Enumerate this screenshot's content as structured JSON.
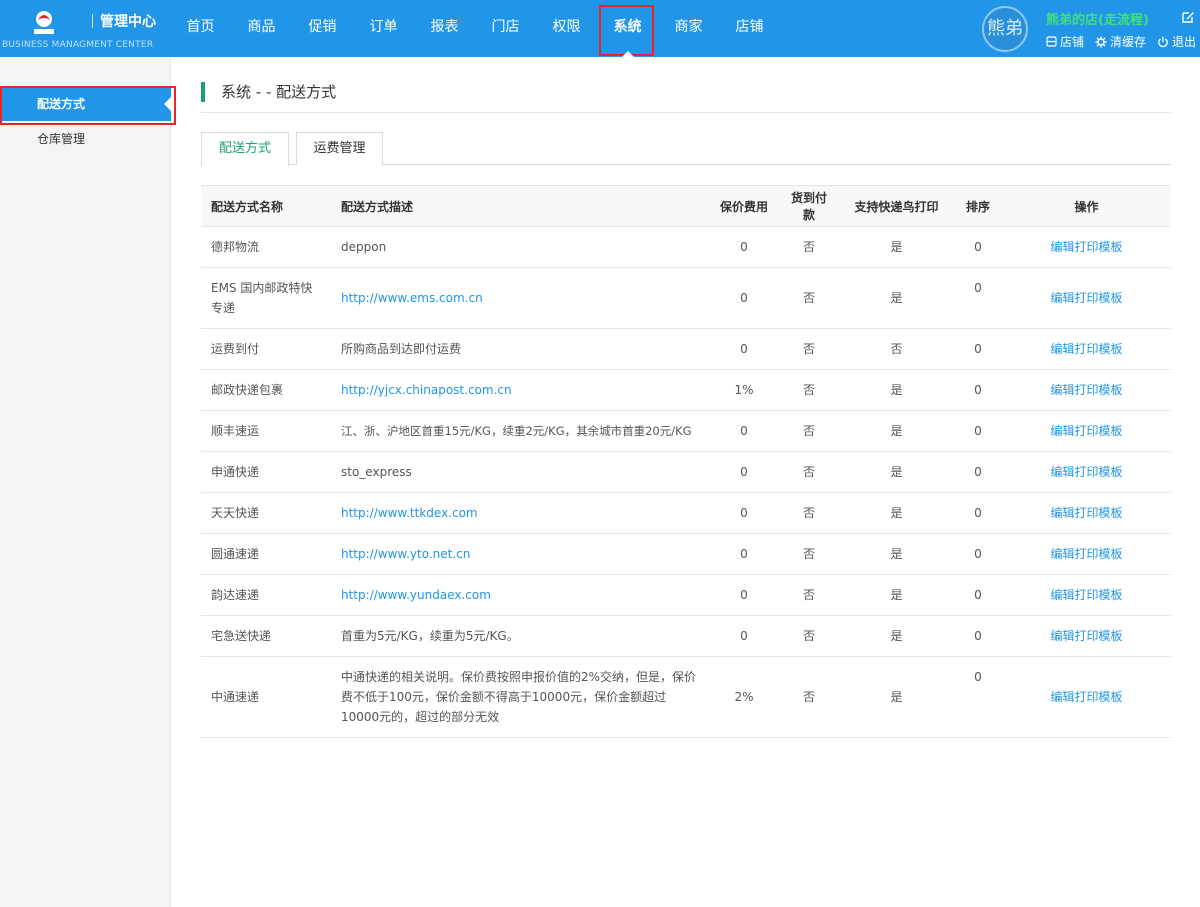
{
  "header": {
    "title": "管理中心",
    "subtitle": "BUSINESS MANAGMENT CENTER",
    "nav": [
      "首页",
      "商品",
      "促销",
      "订单",
      "报表",
      "门店",
      "权限",
      "系统",
      "商家",
      "店铺"
    ],
    "active_nav_index": 7,
    "avatar_text": "熊弟",
    "shop_name": "熊弟的店(走流程)",
    "actions": [
      {
        "label": "店铺",
        "icon": "store-icon"
      },
      {
        "label": "清缓存",
        "icon": "gear-icon"
      },
      {
        "label": "退出",
        "icon": "power-icon"
      }
    ],
    "colors": {
      "bar": "#2196e8",
      "active_outline": "#e8232a",
      "shop_name": "#42e07c"
    }
  },
  "sidebar": {
    "items": [
      "配送方式",
      "仓库管理"
    ],
    "active_index": 0
  },
  "page": {
    "title": "系统 - - 配送方式",
    "tabs": [
      "配送方式",
      "运费管理"
    ],
    "active_tab_index": 0
  },
  "table": {
    "headers": [
      "配送方式名称",
      "配送方式描述",
      "保价费用",
      "货到付款",
      "支持快递鸟打印",
      "排序",
      "操作"
    ],
    "rows": [
      {
        "name": "德邦物流",
        "desc": "deppon",
        "fee": "0",
        "cod": "否",
        "kdn": "是",
        "sort": "0",
        "op": "编辑打印模板"
      },
      {
        "name": "EMS 国内邮政特快专递",
        "desc": "http://www.ems.com.cn",
        "fee": "0",
        "cod": "否",
        "kdn": "是",
        "sort": "0",
        "op": "编辑打印模板"
      },
      {
        "name": "运费到付",
        "desc": "所购商品到达即付运费",
        "fee": "0",
        "cod": "否",
        "kdn": "否",
        "sort": "0",
        "op": "编辑打印模板"
      },
      {
        "name": "邮政快递包裹",
        "desc": "http://yjcx.chinapost.com.cn",
        "fee": "1%",
        "cod": "否",
        "kdn": "是",
        "sort": "0",
        "op": "编辑打印模板"
      },
      {
        "name": "顺丰速运",
        "desc": "江、浙、沪地区首重15元/KG，续重2元/KG，其余城市首重20元/KG",
        "fee": "0",
        "cod": "否",
        "kdn": "是",
        "sort": "0",
        "op": "编辑打印模板"
      },
      {
        "name": "申通快递",
        "desc": "sto_express",
        "fee": "0",
        "cod": "否",
        "kdn": "是",
        "sort": "0",
        "op": "编辑打印模板"
      },
      {
        "name": "天天快递",
        "desc": "http://www.ttkdex.com",
        "fee": "0",
        "cod": "否",
        "kdn": "是",
        "sort": "0",
        "op": "编辑打印模板"
      },
      {
        "name": "圆通速递",
        "desc": "http://www.yto.net.cn",
        "fee": "0",
        "cod": "否",
        "kdn": "是",
        "sort": "0",
        "op": "编辑打印模板"
      },
      {
        "name": "韵达速递",
        "desc": "http://www.yundaex.com",
        "fee": "0",
        "cod": "否",
        "kdn": "是",
        "sort": "0",
        "op": "编辑打印模板"
      },
      {
        "name": "宅急送快递",
        "desc": "首重为5元/KG，续重为5元/KG。",
        "fee": "0",
        "cod": "否",
        "kdn": "是",
        "sort": "0",
        "op": "编辑打印模板"
      },
      {
        "name": "中通速递",
        "desc": "中通快递的相关说明。保价费按照申报价值的2%交纳，但是，保价费不低于100元，保价金额不得高于10000元，保价金额超过10000元的，超过的部分无效",
        "fee": "2%",
        "cod": "否",
        "kdn": "是",
        "sort": "0",
        "op": "编辑打印模板"
      }
    ]
  }
}
